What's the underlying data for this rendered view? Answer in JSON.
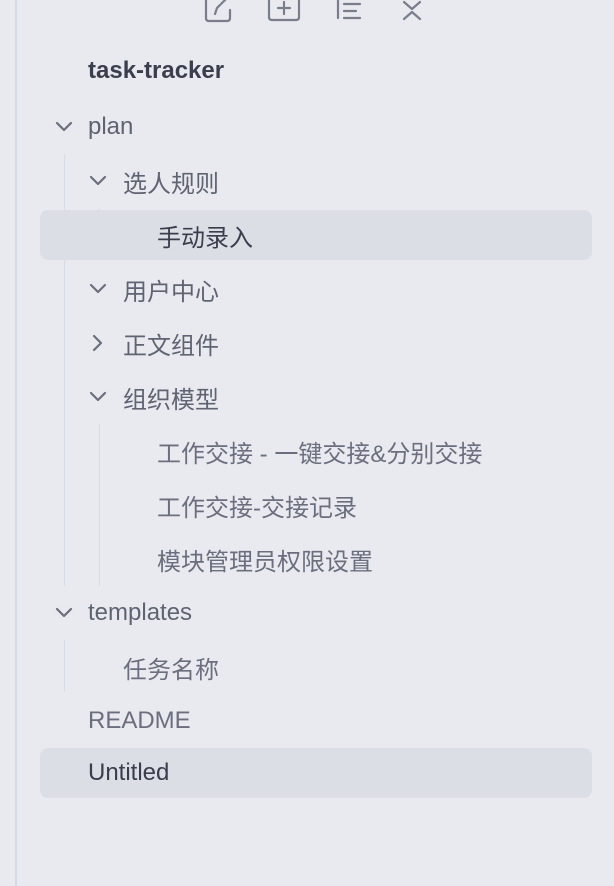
{
  "toolbar": {
    "icons": [
      "new-note-icon",
      "new-folder-icon",
      "sort-icon",
      "collapse-all-icon"
    ]
  },
  "vault": {
    "name": "task-tracker"
  },
  "tree": {
    "plan": {
      "label": "plan",
      "xuanren": {
        "label": "选人规则",
        "child": "手动录入"
      },
      "yonghu": {
        "label": "用户中心"
      },
      "zhengwen": {
        "label": "正文组件"
      },
      "zuzhi": {
        "label": "组织模型",
        "children": [
          "工作交接 - 一键交接&分别交接",
          "工作交接-交接记录",
          "模块管理员权限设置"
        ]
      }
    },
    "templates": {
      "label": "templates",
      "children": [
        "任务名称"
      ]
    },
    "readme": "README",
    "untitled": "Untitled"
  },
  "colors": {
    "background": "#e9eaef",
    "active_row": "#dcdee6",
    "text": "#5c6070"
  }
}
